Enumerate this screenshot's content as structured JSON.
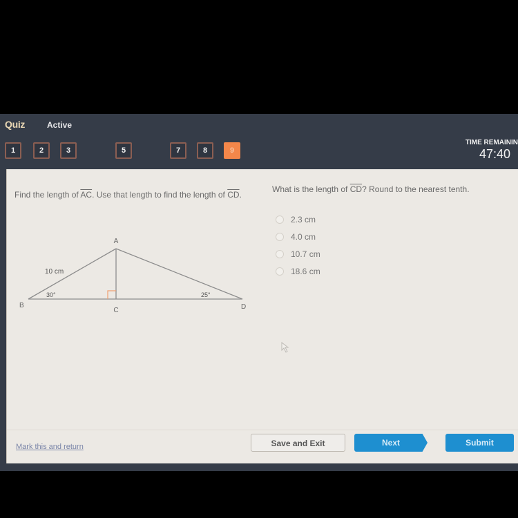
{
  "header": {
    "title": "Quiz",
    "status": "Active",
    "question_nav": [
      {
        "label": "1",
        "current": false
      },
      {
        "label": "2",
        "current": false
      },
      {
        "label": "3",
        "current": false
      },
      {
        "label": "5",
        "current": false
      },
      {
        "label": "7",
        "current": false
      },
      {
        "label": "8",
        "current": false
      },
      {
        "label": "9",
        "current": true
      }
    ],
    "timer_label": "TIME REMAININ",
    "timer_value": "47:40"
  },
  "question": {
    "prompt_part1": "Find the length of ",
    "prompt_seg1": "AC",
    "prompt_part2": ". Use that length to find the length of ",
    "prompt_seg2": "CD",
    "prompt_part3": ".",
    "diagram": {
      "vertex_labels": {
        "A": "A",
        "B": "B",
        "C": "C",
        "D": "D"
      },
      "side_label": "10 cm",
      "angle_B": "30°",
      "angle_D": "25°"
    },
    "ask_part1": "What is the length of ",
    "ask_seg": "CD",
    "ask_part2": "? Round to the nearest tenth.",
    "choices": [
      "2.3 cm",
      "4.0 cm",
      "10.7 cm",
      "18.6 cm"
    ]
  },
  "footer": {
    "mark_link": "Mark this and return",
    "save_label": "Save and Exit",
    "next_label": "Next",
    "submit_label": "Submit"
  },
  "colors": {
    "accent": "#1e8fd0",
    "current_question": "#f4874a",
    "header_bg": "#353c48"
  }
}
